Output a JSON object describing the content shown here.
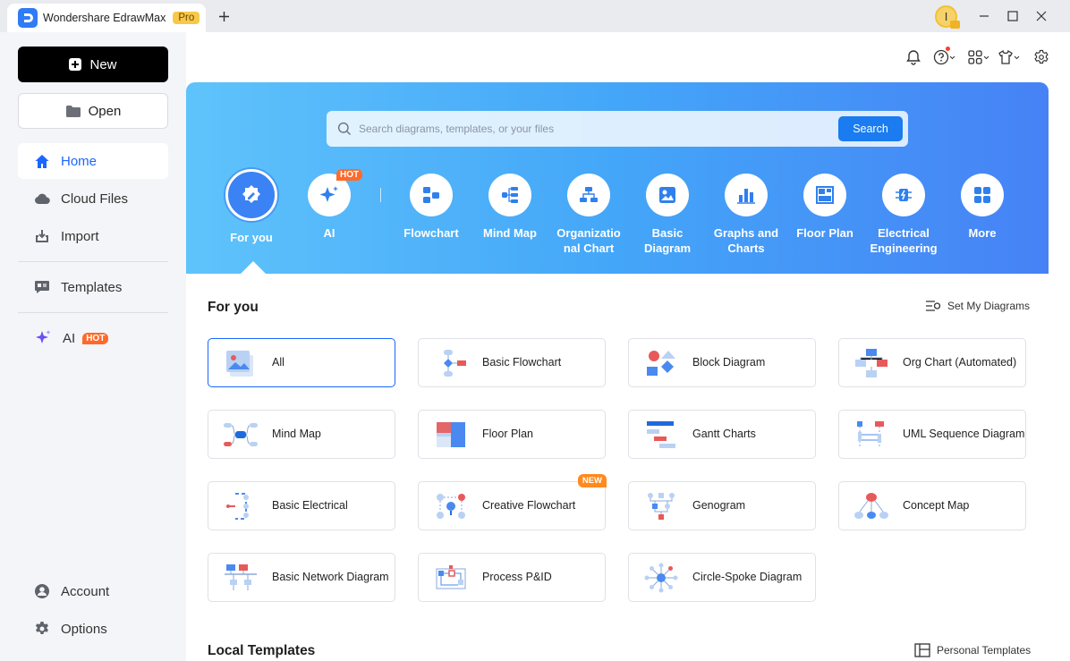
{
  "window": {
    "app_name": "Wondershare EdrawMax",
    "badge": "Pro",
    "user_initial": "I"
  },
  "sidebar": {
    "new_label": "New",
    "open_label": "Open",
    "items": [
      {
        "label": "Home"
      },
      {
        "label": "Cloud Files"
      },
      {
        "label": "Import"
      },
      {
        "label": "Templates"
      },
      {
        "label": "AI",
        "badge": "HOT"
      }
    ],
    "bottom": [
      {
        "label": "Account"
      },
      {
        "label": "Options"
      }
    ]
  },
  "search": {
    "placeholder": "Search diagrams, templates, or your files",
    "button": "Search"
  },
  "categories": [
    {
      "label": "For you",
      "icon": "for-you-icon"
    },
    {
      "label": "AI",
      "icon": "ai-sparkle-icon",
      "badge": "HOT"
    },
    {
      "label": "Flowchart",
      "icon": "flowchart-icon"
    },
    {
      "label": "Mind Map",
      "icon": "mind-map-icon"
    },
    {
      "label": "Organizatio nal Chart",
      "icon": "org-chart-icon"
    },
    {
      "label": "Basic Diagram",
      "icon": "basic-diagram-icon"
    },
    {
      "label": "Graphs and Charts",
      "icon": "bar-chart-icon"
    },
    {
      "label": "Floor Plan",
      "icon": "floor-plan-icon"
    },
    {
      "label": "Electrical Engineering",
      "icon": "electrical-icon"
    },
    {
      "label": "More",
      "icon": "more-grid-icon"
    }
  ],
  "for_you": {
    "title": "For you",
    "link": "Set My Diagrams",
    "cards": [
      {
        "label": "All"
      },
      {
        "label": "Basic Flowchart"
      },
      {
        "label": "Block Diagram"
      },
      {
        "label": "Org Chart (Automated)"
      },
      {
        "label": "Mind Map"
      },
      {
        "label": "Floor Plan"
      },
      {
        "label": "Gantt Charts"
      },
      {
        "label": "UML Sequence Diagram"
      },
      {
        "label": "Basic Electrical"
      },
      {
        "label": "Creative Flowchart",
        "badge": "NEW"
      },
      {
        "label": "Genogram"
      },
      {
        "label": "Concept Map"
      },
      {
        "label": "Basic Network Diagram"
      },
      {
        "label": "Process P&ID"
      },
      {
        "label": "Circle-Spoke Diagram"
      }
    ]
  },
  "local_templates": {
    "title": "Local Templates",
    "link": "Personal Templates"
  }
}
